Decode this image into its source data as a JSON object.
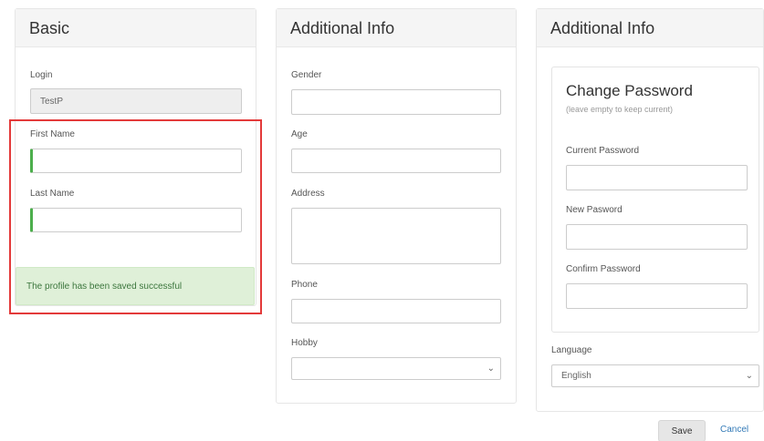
{
  "basic": {
    "title": "Basic",
    "login_label": "Login",
    "login_value": "TestP",
    "first_name_label": "First Name",
    "first_name_value": "",
    "last_name_label": "Last Name",
    "last_name_value": "",
    "success_message": "The profile has been saved successful"
  },
  "additional": {
    "title": "Additional Info",
    "gender_label": "Gender",
    "age_label": "Age",
    "address_label": "Address",
    "phone_label": "Phone",
    "hobby_label": "Hobby",
    "hobby_value": ""
  },
  "additional2": {
    "title": "Additional Info",
    "change_password_title": "Change Password",
    "change_password_hint": "(leave empty to keep current)",
    "current_password_label": "Current Password",
    "new_password_label": "New Pasword",
    "confirm_password_label": "Confirm Password",
    "language_label": "Language",
    "language_value": "English"
  },
  "actions": {
    "save_label": "Save",
    "cancel_label": "Cancel"
  },
  "colors": {
    "success_bg": "#dff0d8",
    "success_text": "#3c763d",
    "highlight": "#e33a3a",
    "valid_marker": "#4cae4c",
    "link": "#337ab7"
  }
}
